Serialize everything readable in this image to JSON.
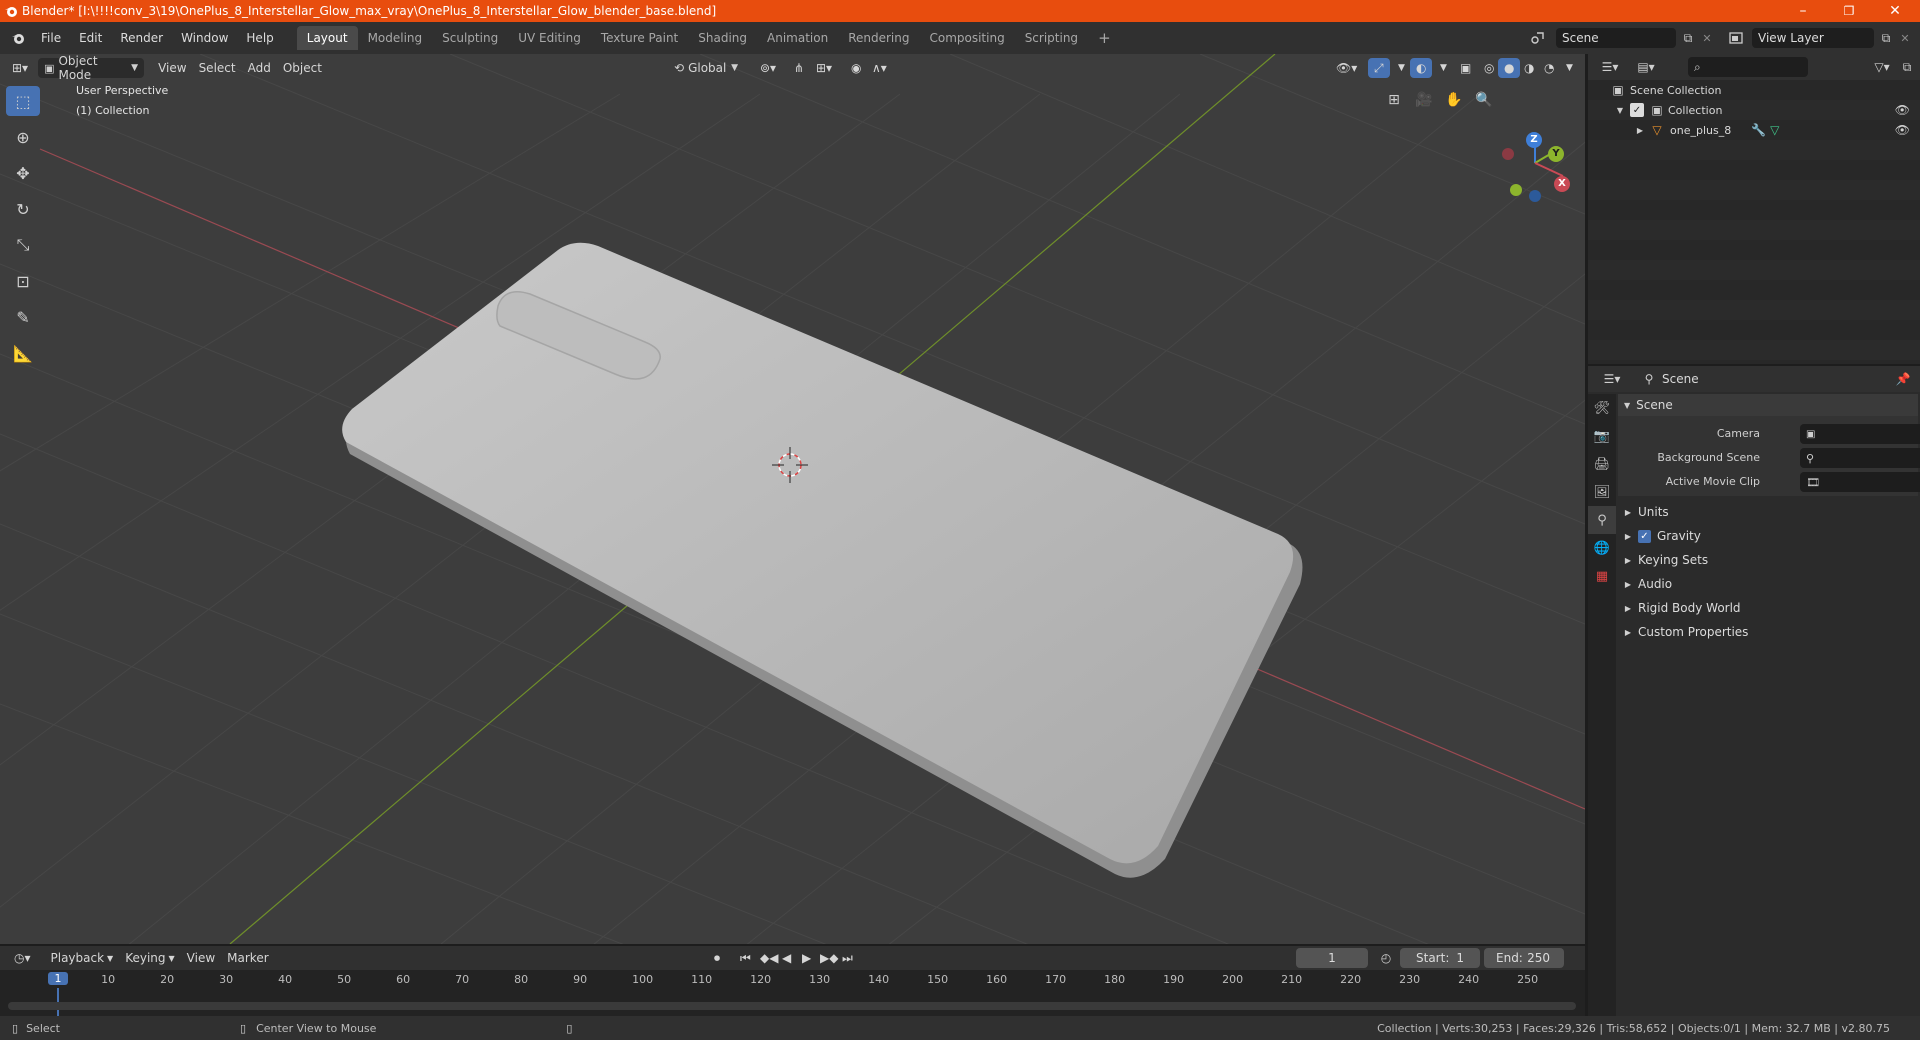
{
  "window": {
    "title": "Blender* [I:\\!!!!conv_3\\19\\OnePlus_8_Interstellar_Glow_max_vray\\OnePlus_8_Interstellar_Glow_blender_base.blend]",
    "controls": {
      "minimize": "–",
      "maximize": "❐",
      "close": "✕"
    }
  },
  "menu": {
    "items": [
      "File",
      "Edit",
      "Render",
      "Window",
      "Help"
    ]
  },
  "workspaces": {
    "tabs": [
      "Layout",
      "Modeling",
      "Sculpting",
      "UV Editing",
      "Texture Paint",
      "Shading",
      "Animation",
      "Rendering",
      "Compositing",
      "Scripting"
    ],
    "active": "Layout",
    "add": "+"
  },
  "scene_selector": {
    "value": "Scene"
  },
  "view_layer_selector": {
    "value": "View Layer"
  },
  "viewport": {
    "mode": "Object Mode",
    "menus": [
      "View",
      "Select",
      "Add",
      "Object"
    ],
    "orientation": "Global",
    "overlay_title": "User Perspective",
    "overlay_subtitle": "(1) Collection",
    "gizmo": {
      "x": "X",
      "y": "Y",
      "z": "Z"
    }
  },
  "outliner": {
    "search_placeholder": "",
    "root": "Scene Collection",
    "collection": "Collection",
    "object": "one_plus_8"
  },
  "properties": {
    "header": "Scene",
    "section": "Scene",
    "camera_label": "Camera",
    "bg_scene_label": "Background Scene",
    "movie_clip_label": "Active Movie Clip",
    "panels": [
      "Units",
      "Gravity",
      "Keying Sets",
      "Audio",
      "Rigid Body World",
      "Custom Properties"
    ]
  },
  "timeline": {
    "menus": [
      "Playback",
      "Keying",
      "View",
      "Marker"
    ],
    "current_frame": "1",
    "start_label": "Start:",
    "start": "1",
    "end_label": "End:",
    "end": "250",
    "ticks": [
      "1",
      "10",
      "20",
      "30",
      "40",
      "50",
      "60",
      "70",
      "80",
      "90",
      "100",
      "110",
      "120",
      "130",
      "140",
      "150",
      "160",
      "170",
      "180",
      "190",
      "200",
      "210",
      "220",
      "230",
      "240",
      "250"
    ]
  },
  "statusbar": {
    "left_action": "Select",
    "middle_action": "Center View to Mouse",
    "stats": "Collection | Verts:30,253 | Faces:29,326 | Tris:58,652 | Objects:0/1 | Mem: 32.7 MB | v2.80.75"
  },
  "colors": {
    "titlebar": "#e84d0e",
    "accent": "#4772b3",
    "x_axis": "#c94a55",
    "y_axis": "#8db52d",
    "z_axis": "#3f7fd8",
    "object_orange": "#e8912c"
  }
}
